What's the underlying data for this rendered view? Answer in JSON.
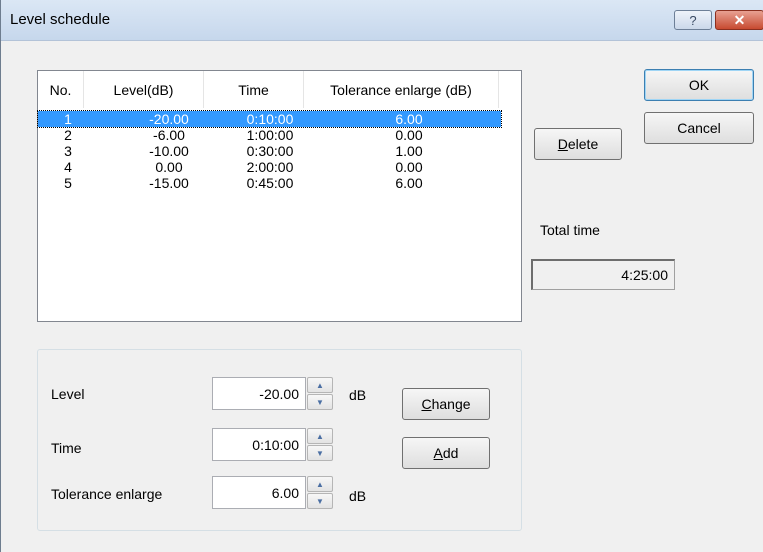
{
  "window": {
    "title": "Level schedule",
    "help_glyph": "?",
    "close_glyph": "✕"
  },
  "table": {
    "columns": [
      "No.",
      "Level(dB)",
      "Time",
      "Tolerance enlarge (dB)"
    ],
    "rows": [
      {
        "no": "1",
        "level": "-20.00",
        "time": "0:10:00",
        "tolerance": "6.00",
        "selected": true
      },
      {
        "no": "2",
        "level": "-6.00",
        "time": "1:00:00",
        "tolerance": "0.00",
        "selected": false
      },
      {
        "no": "3",
        "level": "-10.00",
        "time": "0:30:00",
        "tolerance": "1.00",
        "selected": false
      },
      {
        "no": "4",
        "level": "0.00",
        "time": "2:00:00",
        "tolerance": "0.00",
        "selected": false
      },
      {
        "no": "5",
        "level": "-15.00",
        "time": "0:45:00",
        "tolerance": "6.00",
        "selected": false
      }
    ]
  },
  "buttons": {
    "ok": "OK",
    "cancel": "Cancel",
    "delete_mnemonic": "D",
    "delete_rest": "elete",
    "change_mnemonic": "C",
    "change_rest": "hange",
    "add_mnemonic": "A",
    "add_rest": "dd"
  },
  "total": {
    "label": "Total time",
    "value": "4:25:00"
  },
  "editor": {
    "level_label": "Level",
    "level_value": "-20.00",
    "level_unit": "dB",
    "time_label": "Time",
    "time_value": "0:10:00",
    "tolerance_label": "Tolerance enlarge",
    "tolerance_value": "6.00",
    "tolerance_unit": "dB",
    "spin_up": "▲",
    "spin_down": "▼"
  }
}
